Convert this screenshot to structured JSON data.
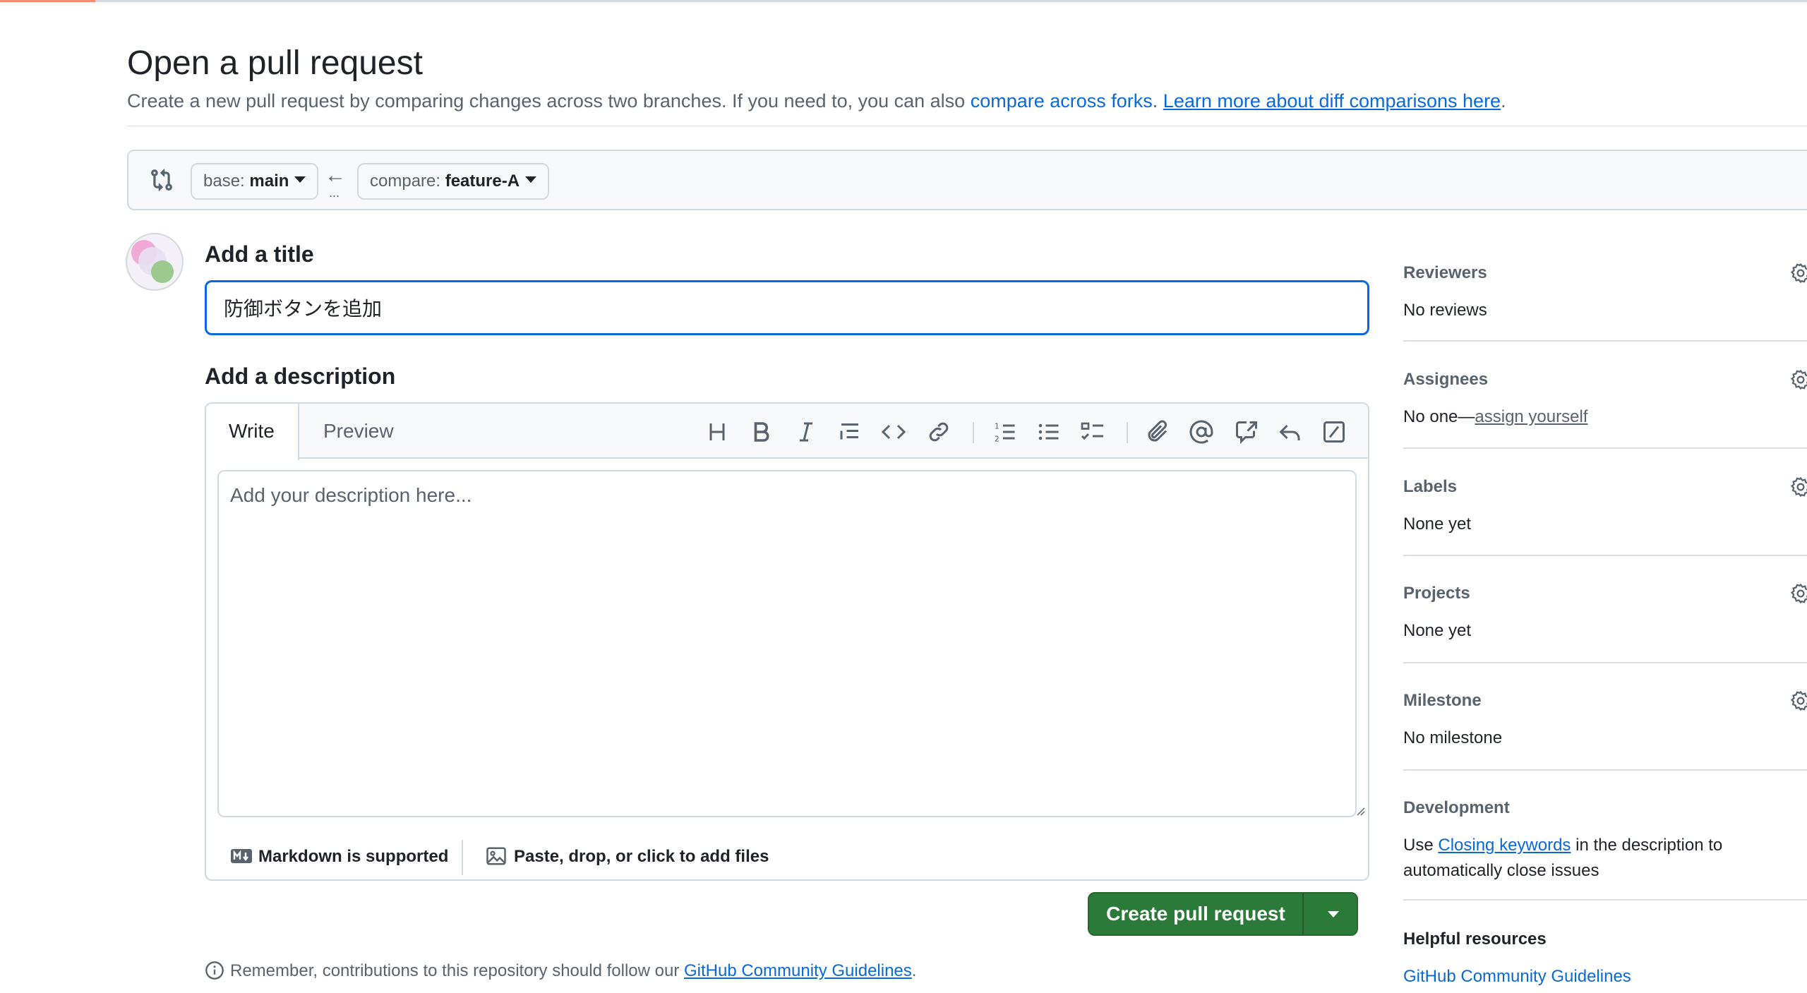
{
  "header": {
    "title": "Open a pull request",
    "subtitle_text": "Create a new pull request by comparing changes across two branches. If you need to, you can also ",
    "compare_forks_link": "compare across forks.",
    "learn_more_link": "Learn more about diff comparisons here",
    "subtitle_end": "."
  },
  "range": {
    "base_prefix": "base: ",
    "base_branch": "main",
    "arrow": "←",
    "dots": "...",
    "compare_prefix": "compare: ",
    "compare_branch": "feature-A"
  },
  "form": {
    "title_label": "Add a title",
    "title_value": "防御ボタンを追加",
    "description_label": "Add a description",
    "tabs": {
      "write": "Write",
      "preview": "Preview"
    },
    "toolbar_icons": [
      "heading-icon",
      "bold-icon",
      "italic-icon",
      "quote-icon",
      "code-icon",
      "link-icon",
      "numbered-list-icon",
      "unordered-list-icon",
      "task-list-icon",
      "attach-icon",
      "mention-icon",
      "cross-reference-icon",
      "saved-reply-icon",
      "slash-commands-icon"
    ],
    "description_placeholder": "Add your description here...",
    "markdown_note": "Markdown is supported",
    "files_note": "Paste, drop, or click to add files"
  },
  "actions": {
    "create_label": "Create pull request"
  },
  "contrib": {
    "text": "Remember, contributions to this repository should follow our ",
    "link": "GitHub Community Guidelines",
    "end": "."
  },
  "sidebar": {
    "reviewers": {
      "label": "Reviewers",
      "value": "No reviews"
    },
    "assignees": {
      "label": "Assignees",
      "value_prefix": "No one—",
      "value_link": "assign yourself"
    },
    "labels": {
      "label": "Labels",
      "value": "None yet"
    },
    "projects": {
      "label": "Projects",
      "value": "None yet"
    },
    "milestone": {
      "label": "Milestone",
      "value": "No milestone"
    },
    "development": {
      "label": "Development",
      "line1_prefix": "Use ",
      "line1_link": "Closing keywords",
      "line1_suffix": " in the description to",
      "line2": "automatically close issues"
    },
    "helpful": {
      "label": "Helpful resources",
      "link": "GitHub Community Guidelines"
    }
  },
  "colors": {
    "accent_blue": "#0969da",
    "create_button_green": "#2c7a39",
    "tab_underline_orange": "#fd8c73"
  }
}
